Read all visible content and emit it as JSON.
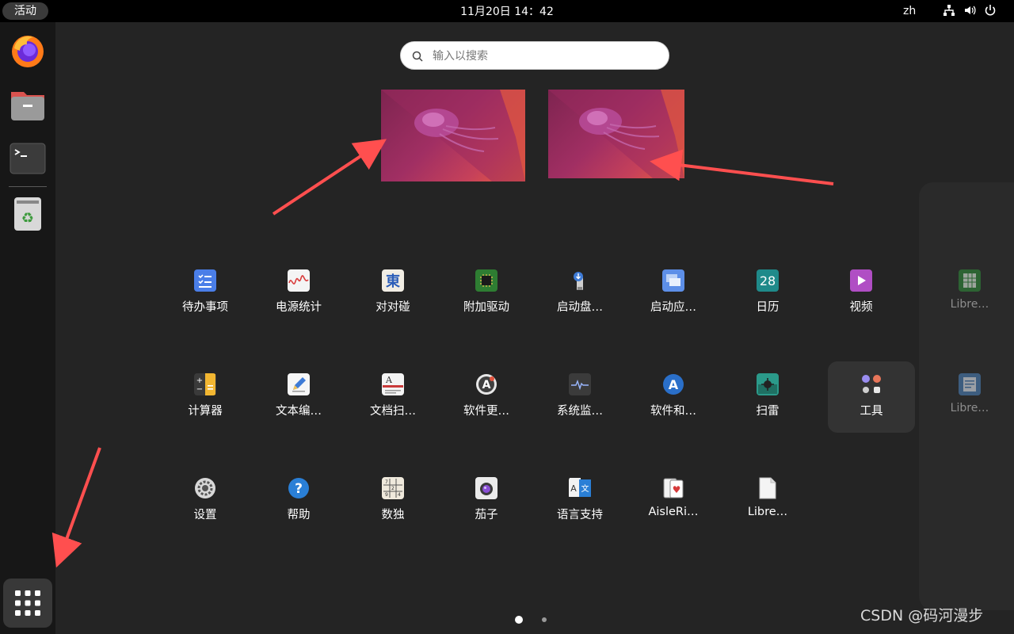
{
  "topbar": {
    "activities": "活动",
    "clock": "11月20日  14：42",
    "lang": "zh",
    "tray_icons": [
      "network-icon",
      "volume-icon",
      "power-icon"
    ]
  },
  "dock": {
    "items": [
      {
        "name": "firefox"
      },
      {
        "name": "files"
      },
      {
        "name": "terminal"
      },
      {
        "name": "trash"
      }
    ]
  },
  "search": {
    "placeholder": "输入以搜索"
  },
  "apps": {
    "row1": [
      "待办事项",
      "电源统计",
      "对对碰",
      "附加驱动",
      "启动盘…",
      "启动应…",
      "日历",
      "视频"
    ],
    "row2": [
      "计算器",
      "文本编…",
      "文档扫…",
      "软件更…",
      "系统监…",
      "软件和…",
      "扫雷",
      "工具"
    ],
    "row3": [
      "设置",
      "帮助",
      "数独",
      "茄子",
      "语言支持",
      "AisleRi…",
      "Libre…"
    ],
    "next_page": [
      "Libre…",
      "Libre…"
    ]
  },
  "calendar_day": "28",
  "watermark": "CSDN @码河漫步",
  "colors": {
    "accent_arrow": "#ff4f4f",
    "topbar": "#000000",
    "overview": "#242424"
  }
}
